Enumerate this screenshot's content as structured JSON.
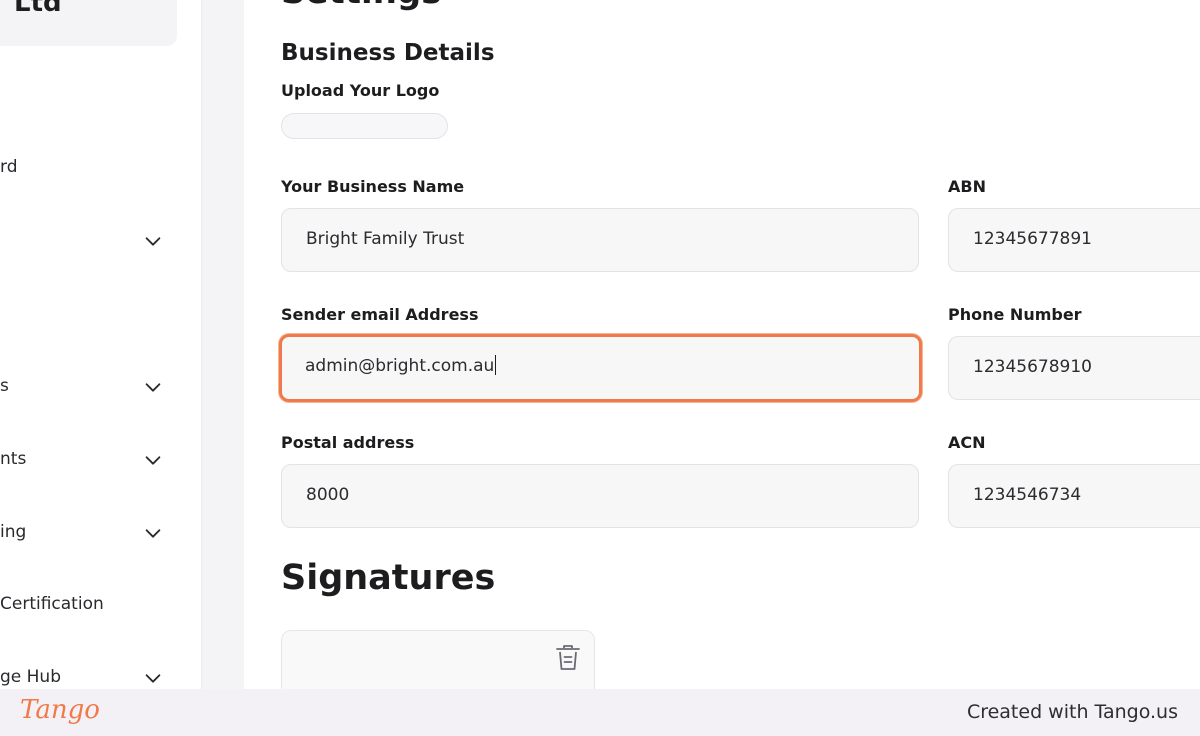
{
  "sidebar": {
    "org_name": "Ltd",
    "items": [
      {
        "label": "rd",
        "has_chevron": false
      },
      {
        "label": "",
        "has_chevron": true
      },
      {
        "label": "s",
        "has_chevron": true
      },
      {
        "label": "nts",
        "has_chevron": true
      },
      {
        "label": "ing",
        "has_chevron": true
      },
      {
        "label": " Certification",
        "has_chevron": false
      },
      {
        "label": "ge Hub",
        "has_chevron": true
      }
    ]
  },
  "page": {
    "title": "Settings",
    "section_title": "Business Details",
    "upload_logo_label": "Upload Your Logo",
    "signatures_title": "Signatures"
  },
  "form": {
    "business_name": {
      "label": "Your Business Name",
      "value": "Bright Family Trust"
    },
    "abn": {
      "label": "ABN",
      "value": "12345677891"
    },
    "sender_email": {
      "label": "Sender email Address",
      "value": "admin@bright.com.au"
    },
    "phone": {
      "label": "Phone Number",
      "value": "12345678910"
    },
    "postal": {
      "label": "Postal address",
      "value": "8000"
    },
    "acn": {
      "label": "ACN",
      "value": "1234546734"
    }
  },
  "footer": {
    "brand": "Tango",
    "credit": "Created with Tango.us"
  },
  "colors": {
    "accent": "#f07a4a",
    "field_bg": "#f7f7f8",
    "sidebar_card": "#f4f4f6"
  }
}
